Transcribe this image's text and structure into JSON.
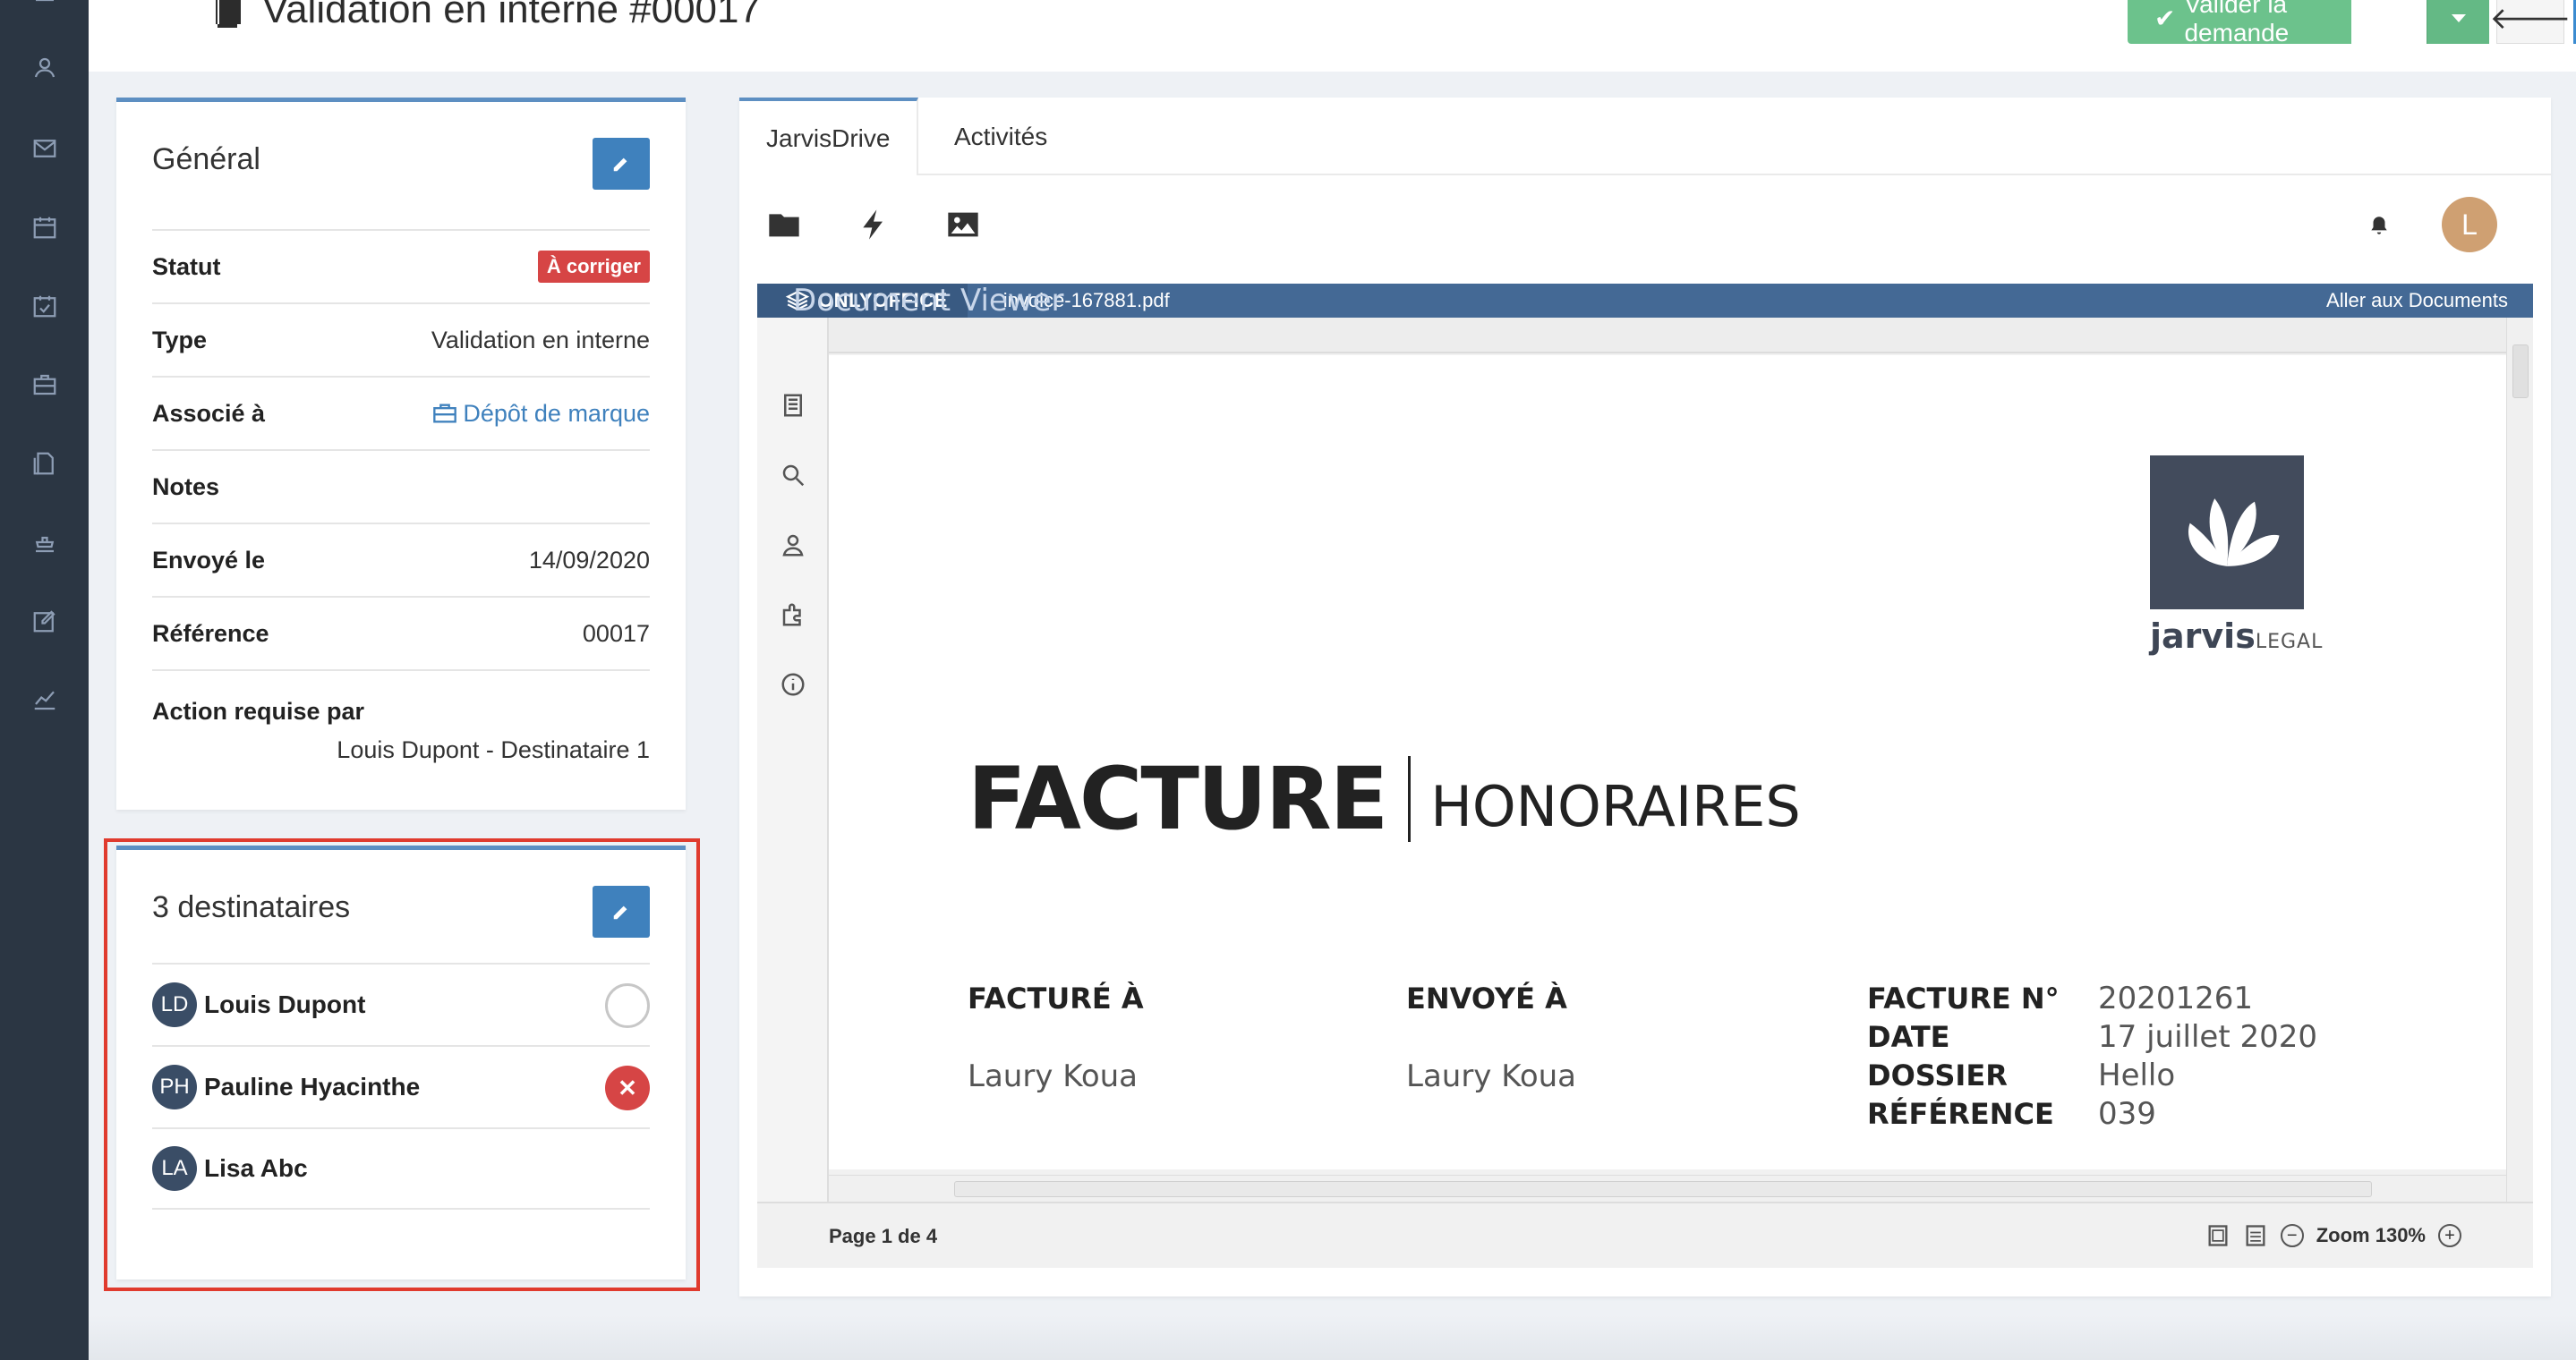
{
  "header": {
    "title": "Validation en interne #00017",
    "validate_label": "Valider la demande",
    "back_icon": "arrow-left-icon",
    "more_label": "···"
  },
  "general": {
    "title": "Général",
    "rows": [
      {
        "label": "Statut",
        "value": "À corriger"
      },
      {
        "label": "Type",
        "value": "Validation en interne"
      },
      {
        "label": "Associé à",
        "value": "Dépôt de marque"
      },
      {
        "label": "Notes",
        "value": ""
      },
      {
        "label": "Envoyé le",
        "value": "14/09/2020"
      },
      {
        "label": "Référence",
        "value": "00017"
      },
      {
        "label": "Action requise par",
        "value": "Louis Dupont - Destinataire 1"
      }
    ]
  },
  "recipients": {
    "title": "3 destinataires",
    "items": [
      {
        "initials": "LD",
        "name": "Louis Dupont",
        "status": "pending"
      },
      {
        "initials": "PH",
        "name": "Pauline Hyacinthe",
        "status": "rejected"
      },
      {
        "initials": "LA",
        "name": "Lisa Abc",
        "status": ""
      }
    ]
  },
  "tabs": [
    {
      "label": "JarvisDrive"
    },
    {
      "label": "Activités"
    }
  ],
  "user": {
    "initial": "L"
  },
  "viewer": {
    "brand": "ONLYOFFICE",
    "mode": "Document Viewer",
    "file": "invoice-167881.pdf",
    "go_docs": "Aller aux Documents",
    "page_info": "Page 1 de 4",
    "zoom": "Zoom 130%"
  },
  "document": {
    "logo_bold": "jarvis",
    "logo_light": "LEGAL",
    "title": "FACTURE",
    "subtitle": "HONORAIRES",
    "billed_to_label": "FACTURÉ À",
    "billed_to": "Laury Koua",
    "sent_to_label": "ENVOYÉ À",
    "sent_to": "Laury Koua",
    "meta": [
      {
        "label": "FACTURE N°",
        "value": "20201261"
      },
      {
        "label": "DATE",
        "value": "17 juillet 2020"
      },
      {
        "label": "DOSSIER",
        "value": "Hello"
      },
      {
        "label": "RÉFÉRENCE",
        "value": "039"
      }
    ]
  },
  "colors": {
    "rail": "#2b3643",
    "accent": "#3f81bd",
    "success": "#6cc28c",
    "danger": "#d64545",
    "highlight": "#e03b2e"
  }
}
